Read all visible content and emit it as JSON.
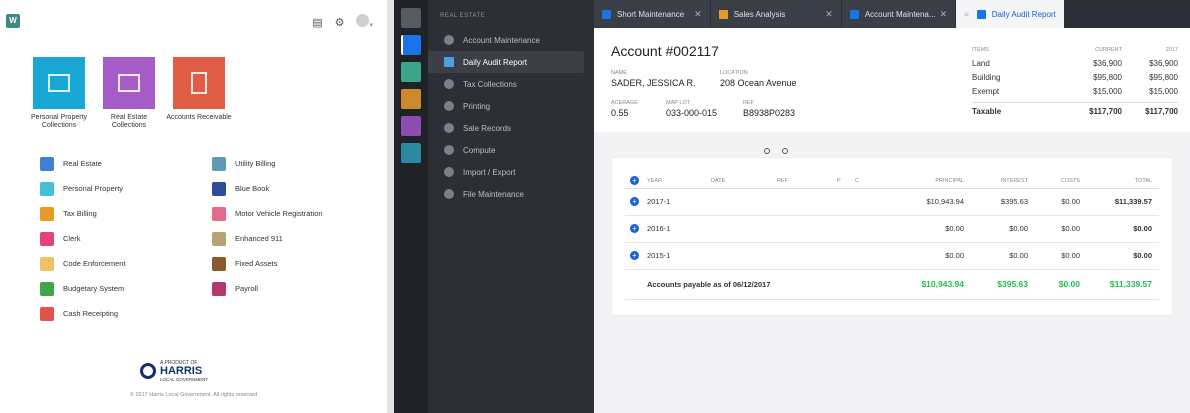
{
  "launcher": {
    "logo": "W",
    "top_icons": [
      "building-icon",
      "gear-icon",
      "user-icon"
    ],
    "tiles": [
      {
        "label": "Personal Property Collections",
        "color": "#19a8d6"
      },
      {
        "label": "Real Estate Collections",
        "color": "#a55cc6"
      },
      {
        "label": "Accounts Receivable",
        "color": "#df5c45"
      }
    ],
    "apps": [
      {
        "label": "Real Estate",
        "color": "#3f7fd4"
      },
      {
        "label": "Utility Billing",
        "color": "#5f9ab8"
      },
      {
        "label": "Personal Property",
        "color": "#46c1d4"
      },
      {
        "label": "Blue Book",
        "color": "#2c4e9b"
      },
      {
        "label": "Tax Billing",
        "color": "#e89a27"
      },
      {
        "label": "Motor Vehicle Registration",
        "color": "#e16b8b"
      },
      {
        "label": "Clerk",
        "color": "#e0457a"
      },
      {
        "label": "Enhanced 911",
        "color": "#b8a176"
      },
      {
        "label": "Code Enforcement",
        "color": "#efc064"
      },
      {
        "label": "Fixed Assets",
        "color": "#8a5a2f"
      },
      {
        "label": "Budgetary System",
        "color": "#3ea548"
      },
      {
        "label": "Payroll",
        "color": "#b3396d"
      },
      {
        "label": "Cash Receipting",
        "color": "#e2524a"
      }
    ],
    "brand": {
      "line1": "A PRODUCT OF",
      "line2": "HARRIS",
      "line3": "LOCAL GOVERNMENT"
    },
    "copyright": "© 2017 Harris Local Government. All rights reserved"
  },
  "iconbar": [
    {
      "name": "grid-icon",
      "color": "#555b63"
    },
    {
      "name": "home-icon",
      "color": "#1a73e8"
    },
    {
      "name": "person-icon",
      "color": "#3aa58a"
    },
    {
      "name": "book-icon",
      "color": "#c98b2a"
    },
    {
      "name": "folder-icon",
      "color": "#8e4bb1"
    },
    {
      "name": "card-icon",
      "color": "#2a8aa0"
    }
  ],
  "nav": {
    "section": "REAL ESTATE",
    "items": [
      {
        "label": "Account Maintenance",
        "active": false
      },
      {
        "label": "Daily Audit Report",
        "active": true
      },
      {
        "label": "Tax Collections",
        "active": false
      },
      {
        "label": "Printing",
        "active": false
      },
      {
        "label": "Sale Records",
        "active": false
      },
      {
        "label": "Compute",
        "active": false
      },
      {
        "label": "Import / Export",
        "active": false
      },
      {
        "label": "File Maintenance",
        "active": false
      }
    ]
  },
  "tabs": [
    {
      "label": "Short Maintenance",
      "color": "#1a73e8",
      "active": false
    },
    {
      "label": "Sales Analysis",
      "color": "#e89a27",
      "active": false
    },
    {
      "label": "Account Maintena...",
      "color": "#1a73e8",
      "active": false
    },
    {
      "label": "Daily Audit Report",
      "color": "#1a73e8",
      "active": true
    }
  ],
  "account": {
    "title": "Account #002117",
    "name_label": "NAME",
    "name": "SADER, JESSICA R.",
    "location_label": "LOCATION",
    "location": "208 Ocean Avenue",
    "acreage_label": "ACERAGE",
    "acreage": "0.55",
    "maplot_label": "MAP LOT",
    "maplot": "033-000-015",
    "ref_label": "REF",
    "ref": "B8938P0283"
  },
  "values": {
    "headers": [
      "ITEMS",
      "CURRENT",
      "2017"
    ],
    "rows": [
      [
        "Land",
        "$36,900",
        "$36,900"
      ],
      [
        "Building",
        "$95,800",
        "$95,800"
      ],
      [
        "Exempt",
        "$15,000",
        "$15,000"
      ]
    ],
    "total": [
      "Taxable",
      "$117,700",
      "$117,700"
    ]
  },
  "audit": {
    "headers": [
      "YEAR",
      "DATE",
      "REF",
      "P",
      "C",
      "PRINCIPAL",
      "INTEREST",
      "COSTS",
      "TOTAL"
    ],
    "rows": [
      {
        "year": "2017-1",
        "principal": "$10,943.94",
        "interest": "$395.63",
        "costs": "$0.00",
        "total": "$11,339.57"
      },
      {
        "year": "2016-1",
        "principal": "$0.00",
        "interest": "$0.00",
        "costs": "$0.00",
        "total": "$0.00"
      },
      {
        "year": "2015-1",
        "principal": "$0.00",
        "interest": "$0.00",
        "costs": "$0.00",
        "total": "$0.00"
      }
    ],
    "footer": {
      "label": "Accounts payable as of 06/12/2017",
      "principal": "$10,943.94",
      "interest": "$395.63",
      "costs": "$0.00",
      "total": "$11,339.57"
    }
  }
}
